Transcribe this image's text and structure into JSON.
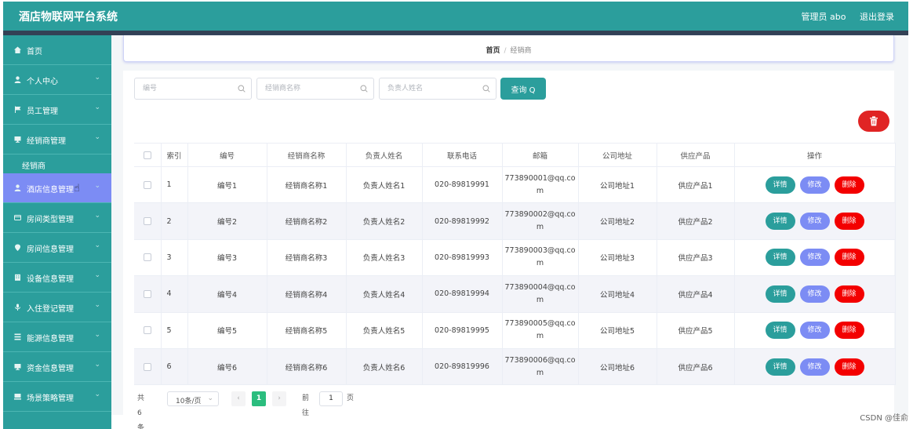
{
  "header": {
    "title": "酒店物联网平台系统",
    "admin": "管理员 abo",
    "logout": "退出登录"
  },
  "sidebar": {
    "items": [
      {
        "label": "首页",
        "icon": "home-icon"
      },
      {
        "label": "个人中心",
        "icon": "user-icon"
      },
      {
        "label": "员工管理",
        "icon": "flag-icon"
      },
      {
        "label": "经销商管理",
        "icon": "monitor-icon"
      },
      {
        "label": "经销商",
        "sub": true
      },
      {
        "label": "酒店信息管理",
        "icon": "user-icon",
        "active": true
      },
      {
        "label": "房间类型管理",
        "icon": "card-icon"
      },
      {
        "label": "房间信息管理",
        "icon": "pin-icon"
      },
      {
        "label": "设备信息管理",
        "icon": "building-icon"
      },
      {
        "label": "入住登记管理",
        "icon": "mic-icon"
      },
      {
        "label": "能源信息管理",
        "icon": "grid-icon"
      },
      {
        "label": "资金信息管理",
        "icon": "monitor-icon"
      },
      {
        "label": "场景策略管理",
        "icon": "pc-icon"
      }
    ]
  },
  "breadcrumb": {
    "home": "首页",
    "separator": "/",
    "current": "经销商"
  },
  "search": {
    "code_placeholder": "编号",
    "name_placeholder": "经销商名称",
    "person_placeholder": "负责人姓名",
    "query_label": "查询 Q"
  },
  "table": {
    "headers": [
      "索引",
      "编号",
      "经销商名称",
      "负责人姓名",
      "联系电话",
      "邮箱",
      "公司地址",
      "供应产品",
      "操作"
    ],
    "rows": [
      {
        "idx": "1",
        "code": "编号1",
        "name": "经销商名称1",
        "person": "负责人姓名1",
        "phone": "020-89819991",
        "email": "773890001@qq.com",
        "address": "公司地址1",
        "product": "供应产品1"
      },
      {
        "idx": "2",
        "code": "编号2",
        "name": "经销商名称2",
        "person": "负责人姓名2",
        "phone": "020-89819992",
        "email": "773890002@qq.com",
        "address": "公司地址2",
        "product": "供应产品2"
      },
      {
        "idx": "3",
        "code": "编号3",
        "name": "经销商名称3",
        "person": "负责人姓名3",
        "phone": "020-89819993",
        "email": "773890003@qq.com",
        "address": "公司地址3",
        "product": "供应产品3"
      },
      {
        "idx": "4",
        "code": "编号4",
        "name": "经销商名称4",
        "person": "负责人姓名4",
        "phone": "020-89819994",
        "email": "773890004@qq.com",
        "address": "公司地址4",
        "product": "供应产品4"
      },
      {
        "idx": "5",
        "code": "编号5",
        "name": "经销商名称5",
        "person": "负责人姓名5",
        "phone": "020-89819995",
        "email": "773890005@qq.com",
        "address": "公司地址5",
        "product": "供应产品5"
      },
      {
        "idx": "6",
        "code": "编号6",
        "name": "经销商名称6",
        "person": "负责人姓名6",
        "phone": "020-89819996",
        "email": "773890006@qq.com",
        "address": "公司地址6",
        "product": "供应产品6"
      }
    ],
    "ops": {
      "detail": "详情",
      "edit": "修改",
      "delete": "删除"
    }
  },
  "pagination": {
    "total": "共 6 条",
    "page_size": "10条/页",
    "current_page": "1",
    "goto_label": "前往",
    "goto_value": "1",
    "page_suffix": "页"
  },
  "watermark": "CSDN @佳俞",
  "colors": {
    "primary": "#2b9e9c",
    "accent": "#7c8cf4",
    "danger": "#f30000",
    "page_active": "#2bbd7e"
  }
}
